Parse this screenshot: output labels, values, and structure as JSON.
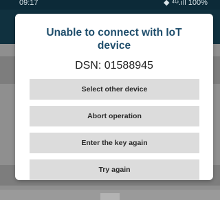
{
  "status_bar": {
    "time": "09:17",
    "indicators": "◆ ⁴ᴳ.ıll 100%",
    "battery_icon": "battery-icon"
  },
  "dialog": {
    "title": "Unable to connect with IoT device",
    "subtitle": "DSN: 01588945",
    "buttons": [
      {
        "label": "Select other device"
      },
      {
        "label": "Abort operation"
      },
      {
        "label": "Enter the key again"
      },
      {
        "label": "Try again"
      }
    ]
  },
  "colors": {
    "title": "#1f4e6c",
    "button_bg": "#dcdcdc",
    "header": "#10313f",
    "scrim": "#8f8f8f"
  }
}
